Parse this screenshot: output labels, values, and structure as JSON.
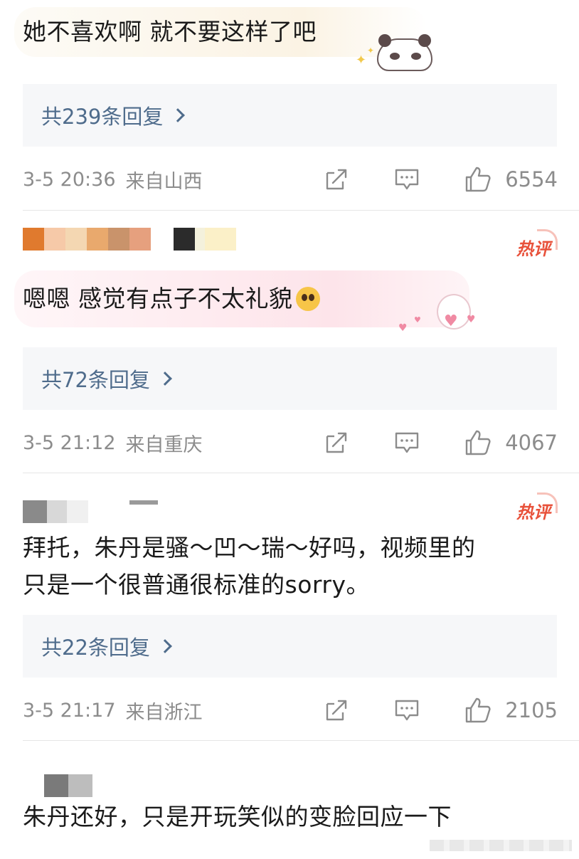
{
  "comments": [
    {
      "text": "她不喜欢啊 就不要这样了吧",
      "replies": "共239条回复",
      "date": "3-5 20:36",
      "location": "来自山西",
      "likes": "6554"
    },
    {
      "badge": "热评",
      "text": "嗯嗯 感觉有点子不太礼貌",
      "replies": "共72条回复",
      "date": "3-5 21:12",
      "location": "来自重庆",
      "likes": "4067"
    },
    {
      "badge": "热评",
      "text_line1": "拜托，朱丹是骚～凹～瑞～好吗，视频里的",
      "text_line2": "只是一个很普通很标准的sorry。",
      "replies": "共22条回复",
      "date": "3-5 21:17",
      "location": "来自浙江",
      "likes": "2105"
    },
    {
      "text": "朱丹还好，只是开玩笑似的变脸回应一下"
    }
  ],
  "icons": {
    "share": "share-icon",
    "comment": "comment-icon",
    "like": "thumbs-up-icon"
  },
  "colors": {
    "reply_link": "#4f6c8c",
    "meta_text": "#8c8c8c",
    "hot_badge": "#e8513a",
    "reply_bg": "#f6f7f9"
  }
}
